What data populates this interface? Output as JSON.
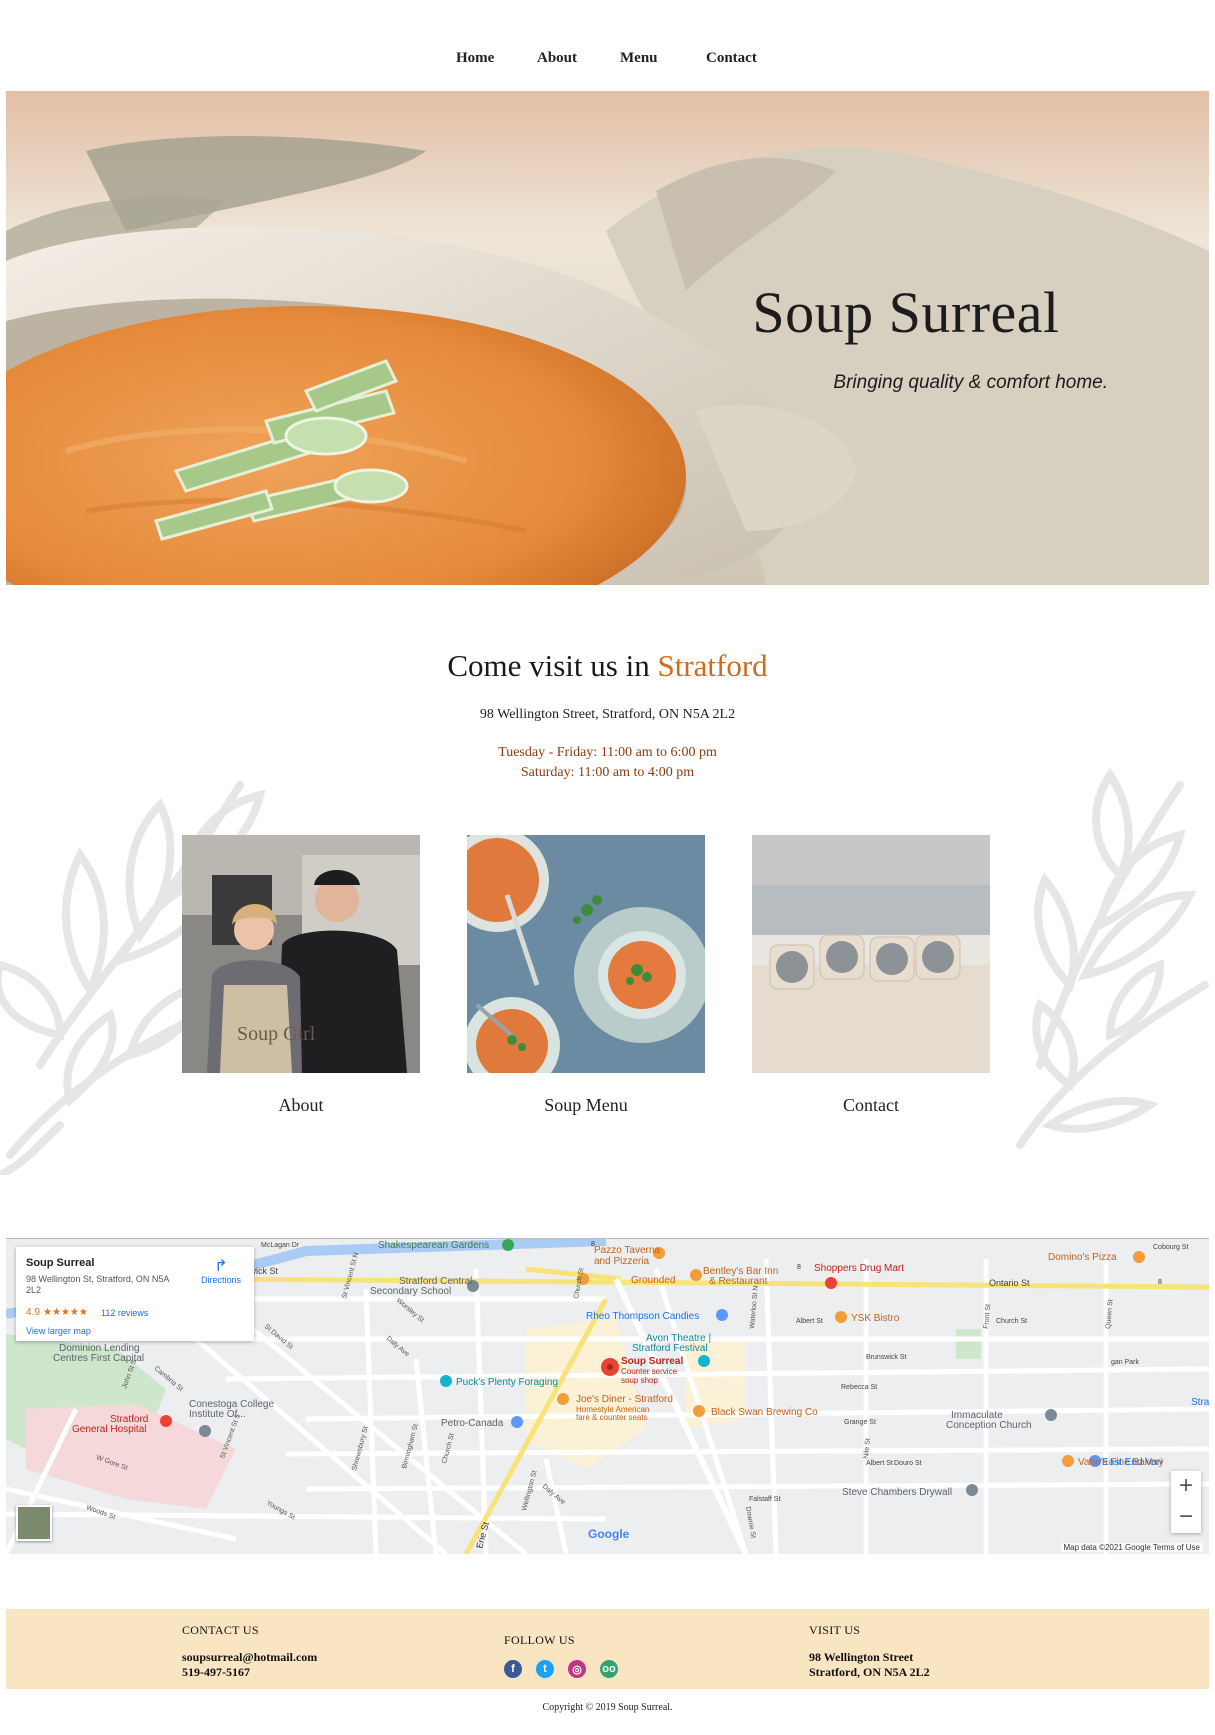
{
  "nav": {
    "items": [
      "Home",
      "About",
      "Menu",
      "Contact"
    ]
  },
  "hero": {
    "title": "Soup Surreal",
    "subtitle": "Bringing quality & comfort home."
  },
  "visit": {
    "title_prefix": "Come visit us in",
    "title_city": "Stratford",
    "address": "98 Wellington Street, Stratford, ON N5A 2L2",
    "hours": [
      "Tuesday - Friday: 11:00 am to 6:00 pm",
      "Saturday: 11:00 am to 4:00 pm"
    ]
  },
  "cards": [
    {
      "caption": "About",
      "apron_text": "Soup Girl"
    },
    {
      "caption": "Soup Menu"
    },
    {
      "caption": "Contact"
    }
  ],
  "map": {
    "info": {
      "name": "Soup Surreal",
      "address": "98 Wellington St, Stratford, ON N5A 2L2",
      "rating": "4.9",
      "stars": "★★★★★",
      "reviews": "112 reviews",
      "directions": "Directions",
      "larger_map": "View larger map"
    },
    "attribution": "Map data ©2021 Google    Terms of Use",
    "logo": "Google",
    "zoom_in": "+",
    "zoom_out": "−",
    "places": [
      "Shakespearean Gardens",
      "Pazzo Taverna",
      "and Pizzeria",
      "Bentley's Bar Inn",
      "& Restaurant",
      "Shoppers Drug Mart",
      "Domino's Pizza",
      "Grounded",
      "Stratford Central",
      "Secondary School",
      "Rheo Thompson Candies",
      "YSK Bistro",
      "Avon Theatre |",
      "Stratford Festival",
      "Dominion Lending",
      "Centres First Capital",
      "Soup Surreal",
      "Counter service",
      "soup shop",
      "Puck's Plenty Foraging",
      "Joe's Diner - Stratford",
      "Homestyle American",
      "fare & counter seats",
      "Black Swan Brewing Co",
      "Conestoga College",
      "Institute Of...",
      "Stratford",
      "General Hospital",
      "Petro-Canada",
      "Immaculate",
      "Conception Church",
      "Vann's Fine Bakery",
      "East End Vari",
      "Steve Chambers Drywall",
      "Stra"
    ],
    "streets": [
      "Ontario St",
      "Albert St",
      "Brunswick St",
      "Rebecca St",
      "Grange St",
      "Douro St",
      "Falstaff St",
      "Waterloo St N",
      "Front St",
      "Nile St",
      "Queen St",
      "Cobourg St",
      "St David St",
      "Daly Ave",
      "Worsley St",
      "Cambria St",
      "John St S",
      "W Gore St",
      "Woods St",
      "Youngs St",
      "St Vincent St S",
      "Shrewsbury St",
      "Birmingham St",
      "Church St",
      "Wellington St",
      "Downie St",
      "Erie St",
      "McLagan Dr",
      "St Vincent St N",
      "Church St",
      "gan Park",
      "Albert St",
      "Brunswick St",
      "Douro St"
    ],
    "route_numbers": [
      "8",
      "8",
      "8"
    ]
  },
  "footer": {
    "contact_head": "CONTACT US",
    "email": "soupsurreal@hotmail.com",
    "phone": "519-497-5167",
    "follow_head": "FOLLOW US",
    "social": [
      "facebook-icon",
      "twitter-icon",
      "instagram-icon",
      "tripadvisor-icon"
    ],
    "visit_head": "VISIT US",
    "visit_line1": "98 Wellington Street",
    "visit_line2": "Stratford, ON N5A 2L2"
  },
  "copyright": "Copyright © 2019 Soup Surreal."
}
